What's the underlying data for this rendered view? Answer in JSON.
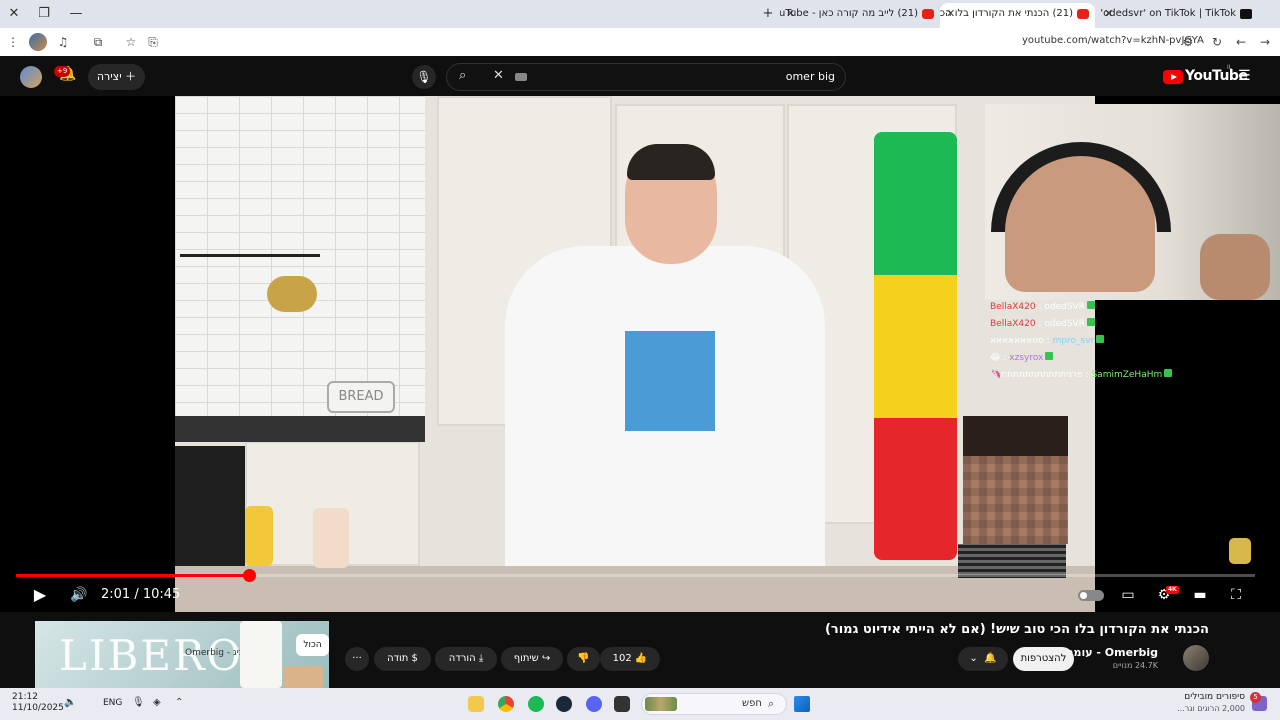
{
  "browser": {
    "tabs": [
      {
        "title": "Find 'odedsvr' on TikTok | TikTok",
        "active": false
      },
      {
        "title": "(21) הכנתי את הקורדון בלו הכי...",
        "active": true
      },
      {
        "title": "(21) לייב מה קורה כאן - YouTube",
        "active": false
      }
    ],
    "url": "youtube.com/watch?v=kzhN-pvJGYA",
    "icons": [
      "close-icon",
      "restore-icon",
      "minimize-icon",
      "new-tab-icon"
    ]
  },
  "youtube": {
    "logo_text": "YouTube",
    "logo_superscript": "IL",
    "search": {
      "value": "omer big"
    },
    "create_label": "יצירה",
    "notifications_badge": "+9"
  },
  "player": {
    "current_time": "2:01",
    "duration": "10:45",
    "time_display": "2:01 / 10:45",
    "progress_fraction": 0.188,
    "quality_badge": "4K",
    "meter_colors": [
      "#1db954",
      "#f5d01d",
      "#e5262a"
    ],
    "chat": [
      {
        "user": "BellaX420",
        "sep": " : ",
        "msg": "odedSVR",
        "color": "#d93b3b"
      },
      {
        "user": "BellaX420",
        "sep": " : ",
        "msg": "odedSVR",
        "color": "#d93b3b"
      },
      {
        "user": "mpro_svr",
        "sep": " : ",
        "msg": "סטאאאאאאא",
        "color": "#7fd3ff"
      },
      {
        "user": "xzsyrox",
        "sep": " : ",
        "msg": "😂",
        "color": "#b16dff"
      },
      {
        "user": "SamimZeHaHm",
        "sep": " : ",
        "msg": "פרגיתתתתתתתתתתת🦄",
        "color": "#7cf06b"
      }
    ]
  },
  "video": {
    "title": "הכנתי את הקורדון בלו הכי טוב שיש! (אם לא הייתי אידיוט גמור)",
    "channel_name": "Omerbig - עומר ביג",
    "subscribers": "24.7K מנויים",
    "join_label": "להצטרפות",
    "like_count": "102",
    "share_label": "שיתוף",
    "download_label": "הורדה",
    "thanks_label": "תודה",
    "more_label": "···"
  },
  "ad": {
    "brand_word": "LIBERO",
    "chip_label": "הכול",
    "channel_text": "עומר ביג - Omerbig"
  },
  "taskbar": {
    "time": "21:12",
    "date": "11/10/2025",
    "language": "ENG",
    "search_text": "חפש",
    "news_title": "סיפורים מובילים",
    "news_sub": "2,000 הרוגים וגר...",
    "news_badge": "5"
  }
}
